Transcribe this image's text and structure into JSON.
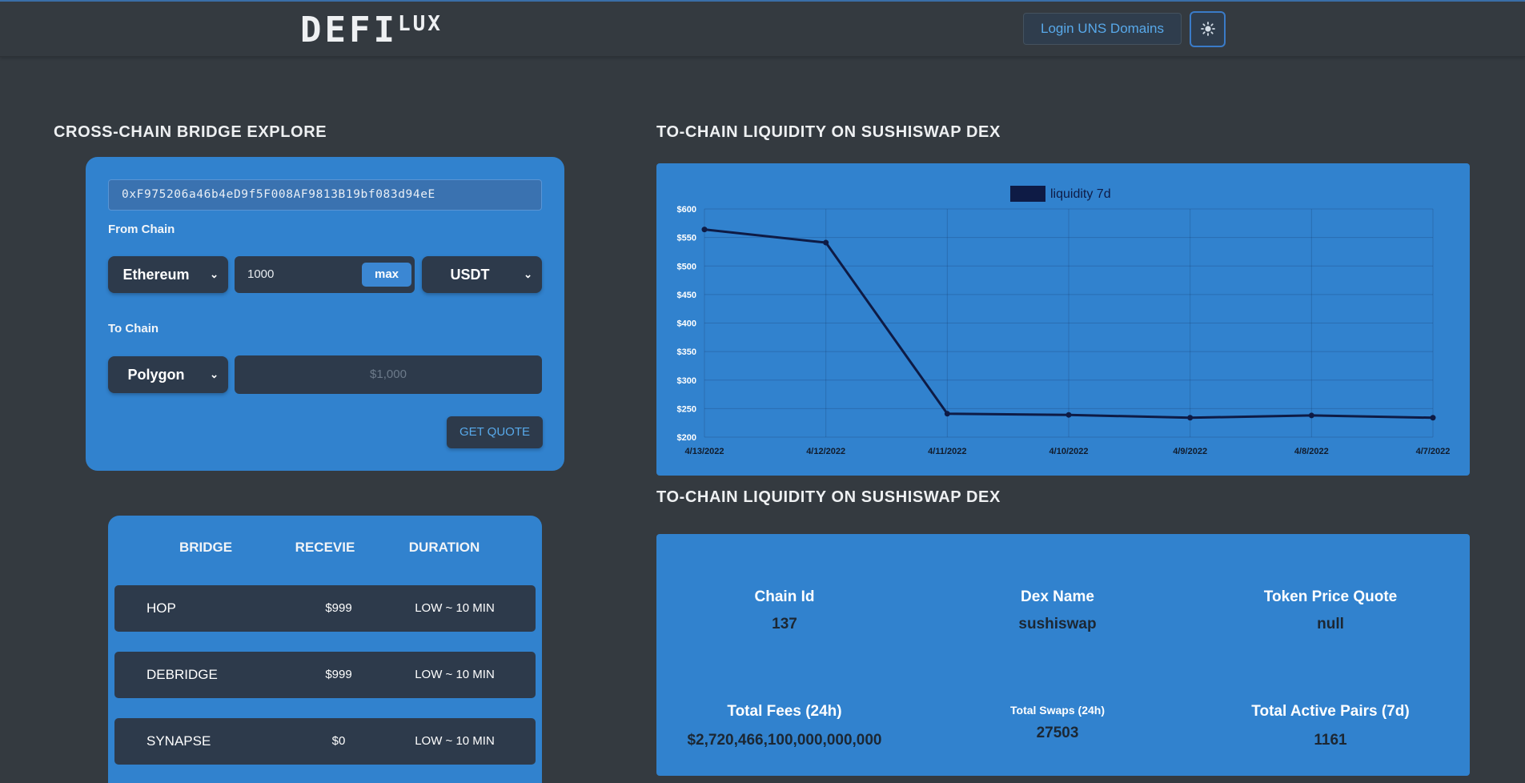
{
  "header": {
    "logo_main": "DEFI",
    "logo_sup": "LUX",
    "login_label": "Login UNS Domains",
    "theme_icon": "sun-icon"
  },
  "bridge": {
    "title": "CROSS-CHAIN BRIDGE EXPLORE",
    "address": "0xF975206a46b4eD9f5F008AF9813B19bf083d94eE",
    "from_label": "From Chain",
    "from_chain": "Ethereum",
    "amount": "1000",
    "max_label": "max",
    "token": "USDT",
    "to_label": "To Chain",
    "to_chain": "Polygon",
    "receive_placeholder": "$1,000",
    "quote_label": "GET QUOTE"
  },
  "routes": {
    "headers": [
      "BRIDGE",
      "RECEVIE",
      "DURATION"
    ],
    "rows": [
      {
        "bridge": "HOP",
        "receive": "$999",
        "duration": "LOW ~ 10 MIN"
      },
      {
        "bridge": "DEBRIDGE",
        "receive": "$999",
        "duration": "LOW ~ 10 MIN"
      },
      {
        "bridge": "SYNAPSE",
        "receive": "$0",
        "duration": "LOW ~ 10 MIN"
      }
    ]
  },
  "chart_section": {
    "title": "TO-CHAIN LIQUIDITY ON SUSHISWAP DEX"
  },
  "chart_data": {
    "type": "line",
    "title": "",
    "xlabel": "",
    "ylabel": "",
    "categories": [
      "4/13/2022",
      "4/12/2022",
      "4/11/2022",
      "4/10/2022",
      "4/9/2022",
      "4/8/2022",
      "4/7/2022"
    ],
    "series": [
      {
        "name": "liquidity 7d",
        "values": [
          564,
          541,
          241,
          239,
          234,
          238,
          234
        ],
        "color": "#0e1b45"
      }
    ],
    "ylim": [
      200,
      600
    ],
    "yticks": [
      "$200",
      "$250",
      "$300",
      "$350",
      "$400",
      "$450",
      "$500",
      "$550",
      "$600"
    ],
    "grid": true,
    "legend": "top-center"
  },
  "stats_section": {
    "title": "TO-CHAIN LIQUIDITY ON SUSHISWAP DEX",
    "chain_id_label": "Chain Id",
    "chain_id": "137",
    "dex_name_label": "Dex Name",
    "dex_name": "sushiswap",
    "token_price_label": "Token Price Quote",
    "token_price": "null",
    "fees_label": "Total Fees (24h)",
    "fees": "$2,720,466,100,000,000,000",
    "swaps_label": "Total Swaps (24h)",
    "swaps": "27503",
    "pairs_label": "Total Active Pairs (7d)",
    "pairs": "1161"
  }
}
